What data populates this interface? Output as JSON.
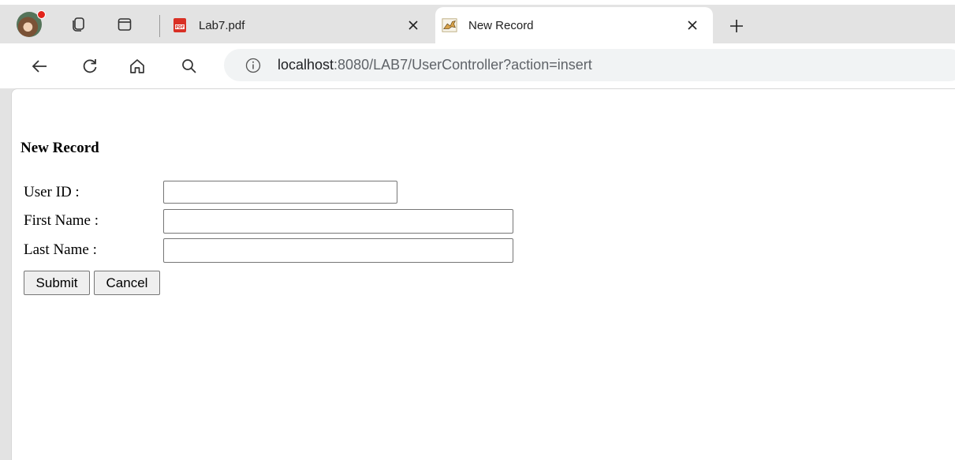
{
  "browser": {
    "tabs": [
      {
        "title": "Lab7.pdf",
        "favicon": "pdf-icon",
        "active": false
      },
      {
        "title": "New Record",
        "favicon": "tomcat-icon",
        "active": true
      }
    ],
    "address_bar": {
      "host": "localhost",
      "rest": ":8080/LAB7/UserController?action=insert"
    }
  },
  "page": {
    "heading": "New Record",
    "fields": [
      {
        "label": "User ID :",
        "value": ""
      },
      {
        "label": "First Name :",
        "value": ""
      },
      {
        "label": "Last Name :",
        "value": ""
      }
    ],
    "buttons": {
      "submit": "Submit",
      "cancel": "Cancel"
    }
  },
  "colors": {
    "tabstrip": "#e3e3e3",
    "page_background": "#ffffff",
    "pdf_red": "#d93025",
    "button_face": "#efefef"
  }
}
